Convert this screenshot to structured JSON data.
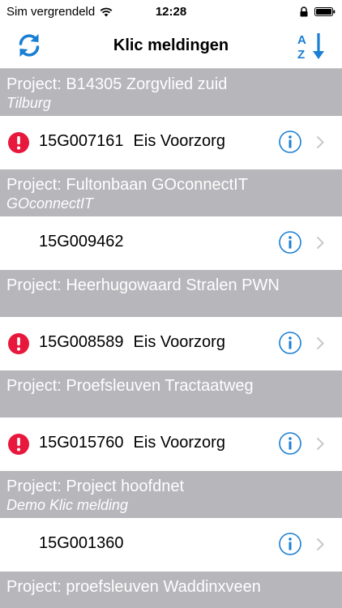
{
  "status_bar": {
    "carrier": "Sim vergrendeld",
    "time": "12:28"
  },
  "nav": {
    "title": "Klic meldingen"
  },
  "colors": {
    "accent": "#1a7fd4",
    "section_bg": "#b6b6bb",
    "alert": "#e8173c"
  },
  "sections": [
    {
      "title": "Project: B14305 Zorgvlied zuid",
      "subtitle": "Tilburg",
      "row": {
        "code": "15G007161",
        "tag": "Eis Voorzorg",
        "alert": true
      }
    },
    {
      "title": "Project: Fultonbaan GOconnectIT",
      "subtitle": "GOconnectIT",
      "row": {
        "code": "15G009462",
        "tag": "",
        "alert": false
      }
    },
    {
      "title": "Project: Heerhugowaard Stralen PWN",
      "subtitle": "",
      "row": {
        "code": "15G008589",
        "tag": "Eis Voorzorg",
        "alert": true
      }
    },
    {
      "title": "Project: Proefsleuven Tractaatweg",
      "subtitle": "",
      "row": {
        "code": "15G015760",
        "tag": "Eis Voorzorg",
        "alert": true
      }
    },
    {
      "title": "Project: Project hoofdnet",
      "subtitle": "Demo Klic melding",
      "row": {
        "code": "15G001360",
        "tag": "",
        "alert": false
      }
    },
    {
      "title": "Project: proefsleuven Waddinxveen",
      "subtitle": ""
    }
  ]
}
